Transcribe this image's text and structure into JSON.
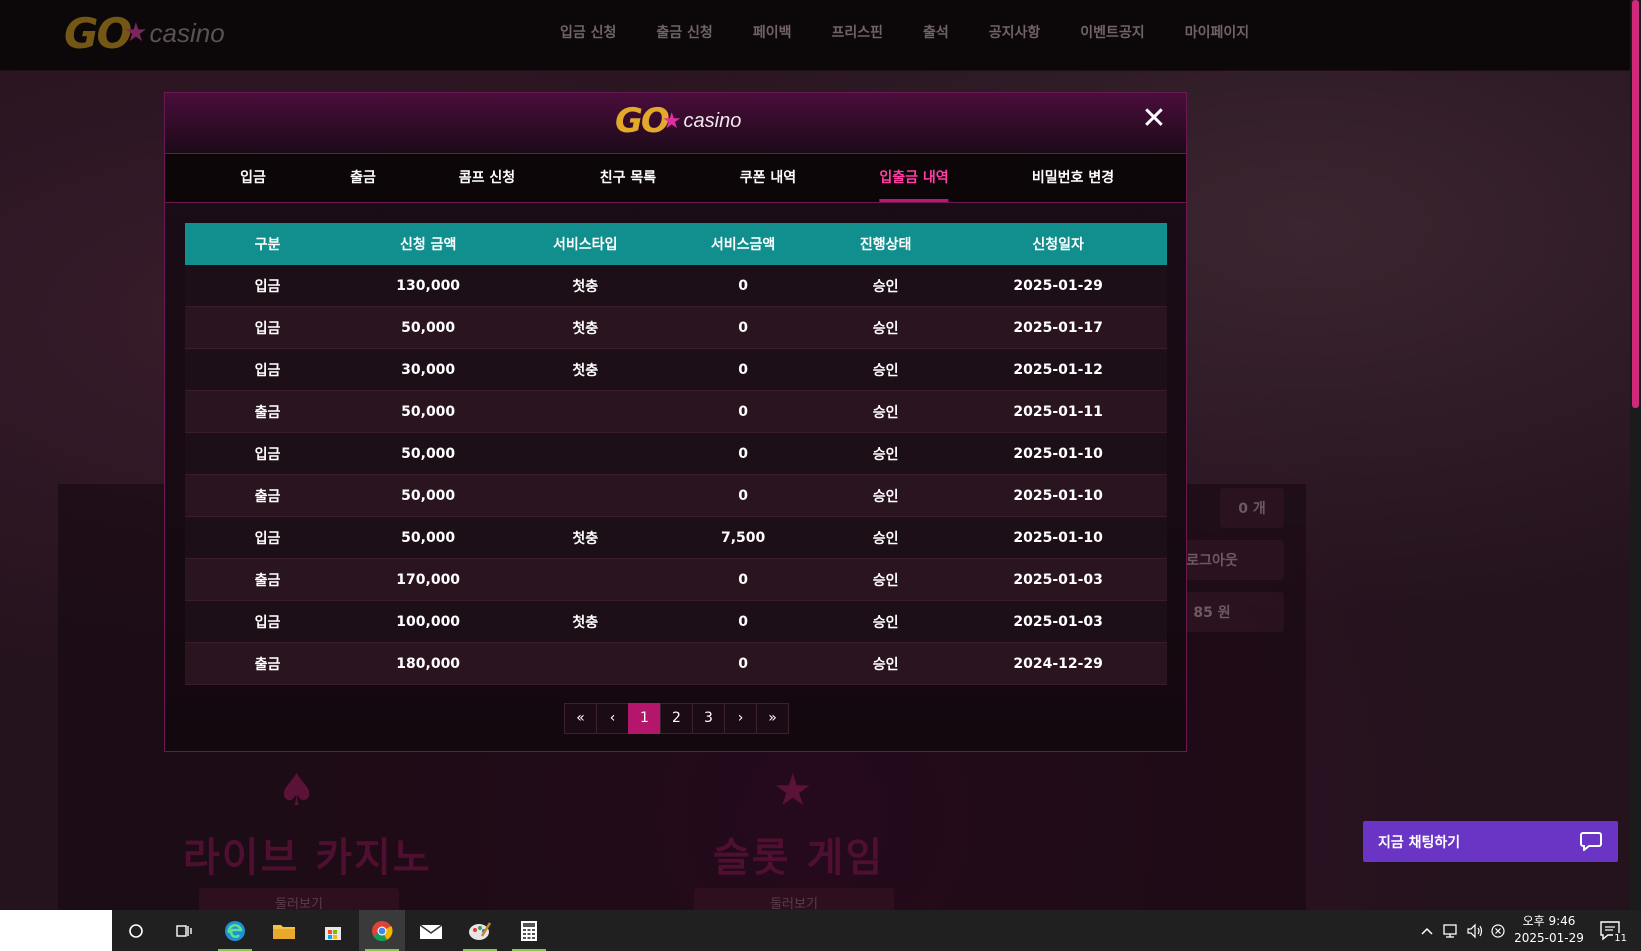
{
  "site": {
    "logo_go": "GO",
    "logo_casino": "casino",
    "nav": [
      "입금 신청",
      "출금 신청",
      "페이백",
      "프리스핀",
      "출석",
      "공지사항",
      "이벤트공지",
      "마이페이지"
    ],
    "bg_count": "0 개",
    "bg_logout": "로그아웃",
    "bg_point": "85 원",
    "bg_live": "라이브 카지노",
    "bg_slot": "슬롯 게임",
    "bg_view1": "둘러보기",
    "bg_view2": "둘러보기"
  },
  "modal": {
    "logo_go": "GO",
    "logo_casino": "casino",
    "close": "✕",
    "tabs": [
      "입금",
      "출금",
      "콤프 신청",
      "친구 목록",
      "쿠폰 내역",
      "입출금 내역",
      "비밀번호 변경"
    ],
    "active_tab": "입출금 내역",
    "table": {
      "headers": [
        "구분",
        "신청 금액",
        "서비스타입",
        "서비스금액",
        "진행상태",
        "신청일자"
      ],
      "rows": [
        [
          "입금",
          "130,000",
          "첫충",
          "0",
          "승인",
          "2025-01-29"
        ],
        [
          "입금",
          "50,000",
          "첫충",
          "0",
          "승인",
          "2025-01-17"
        ],
        [
          "입금",
          "30,000",
          "첫충",
          "0",
          "승인",
          "2025-01-12"
        ],
        [
          "출금",
          "50,000",
          "",
          "0",
          "승인",
          "2025-01-11"
        ],
        [
          "입금",
          "50,000",
          "",
          "0",
          "승인",
          "2025-01-10"
        ],
        [
          "출금",
          "50,000",
          "",
          "0",
          "승인",
          "2025-01-10"
        ],
        [
          "입금",
          "50,000",
          "첫충",
          "7,500",
          "승인",
          "2025-01-10"
        ],
        [
          "출금",
          "170,000",
          "",
          "0",
          "승인",
          "2025-01-03"
        ],
        [
          "입금",
          "100,000",
          "첫충",
          "0",
          "승인",
          "2025-01-03"
        ],
        [
          "출금",
          "180,000",
          "",
          "0",
          "승인",
          "2024-12-29"
        ]
      ]
    },
    "pagination": {
      "first": "«",
      "prev": "‹",
      "pages": [
        "1",
        "2",
        "3"
      ],
      "current": "1",
      "next": "›",
      "last": "»"
    }
  },
  "chat": {
    "label": "지금 채팅하기"
  },
  "taskbar": {
    "clock_time": "오후 9:46",
    "clock_date": "2025-01-29",
    "notification_count": "11"
  },
  "colors": {
    "accent": "#b3166b",
    "table_header": "#118f8f",
    "active_tab": "#ff3ea6",
    "chat": "#6a35c5"
  }
}
